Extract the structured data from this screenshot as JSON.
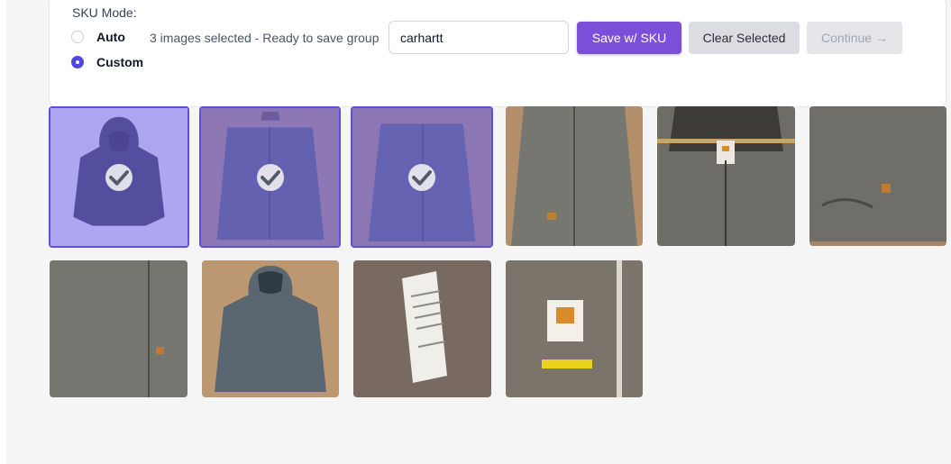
{
  "sku_mode": {
    "label": "SKU Mode:",
    "options": [
      {
        "label": "Auto",
        "checked": false
      },
      {
        "label": "Custom",
        "checked": true
      }
    ]
  },
  "status_text": "3 images selected - Ready to save group",
  "sku_input": {
    "value": "carhartt"
  },
  "buttons": {
    "save": "Save w/ SKU",
    "clear": "Clear Selected",
    "continue": "Continue →"
  },
  "images": [
    {
      "subject": "jacket-front-hood",
      "selected": true
    },
    {
      "subject": "jacket-on-hanger",
      "selected": true
    },
    {
      "subject": "jacket-on-hanger",
      "selected": true
    },
    {
      "subject": "jacket-closeup",
      "selected": false
    },
    {
      "subject": "collar-tag-closeup",
      "selected": false
    },
    {
      "subject": "jacket-pocket-detail",
      "selected": false
    },
    {
      "subject": "jacket-side-closeup",
      "selected": false
    },
    {
      "subject": "jacket-back",
      "selected": false
    },
    {
      "subject": "care-label-closeup",
      "selected": false
    },
    {
      "subject": "brand-label-closeup",
      "selected": false
    }
  ],
  "colors": {
    "accent": "#7b4fd8",
    "selection": "#5b4fe0"
  }
}
